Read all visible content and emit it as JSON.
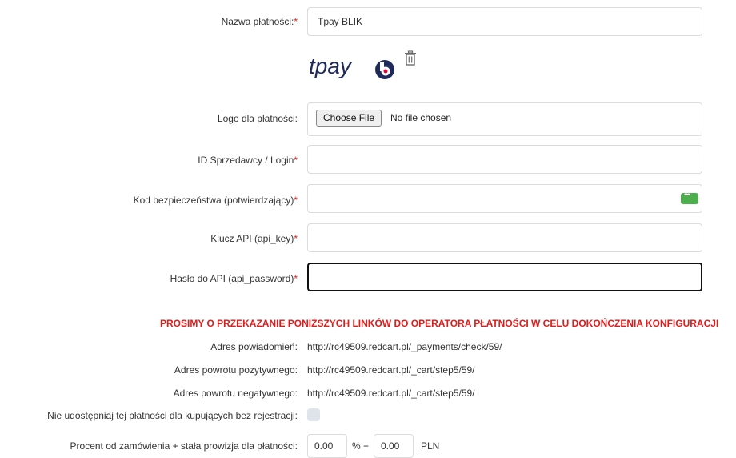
{
  "fields": {
    "payment_name": {
      "label": "Nazwa płatności:",
      "req": "*",
      "value": "Tpay BLIK"
    },
    "payment_logo": {
      "label": "Logo dla płatności:",
      "button": "Choose File",
      "status": "No file chosen"
    },
    "merchant_id": {
      "label": "ID Sprzedawcy / Login",
      "req": "*",
      "value": ""
    },
    "security_code": {
      "label": "Kod bezpieczeństwa (potwierdzający)",
      "req": "*",
      "value": ""
    },
    "api_key": {
      "label": "Klucz API (api_key)",
      "req": "*",
      "value": ""
    },
    "api_password": {
      "label": "Hasło do API (api_password)",
      "req": "*",
      "value": ""
    }
  },
  "logo": {
    "brand_text": "tpay",
    "badge_letter": "b"
  },
  "icons": {
    "delete": "trash-icon",
    "password_manager": "password-key-icon"
  },
  "notice": "PROSIMY O PRZEKAZANIE PONIŻSZYCH LINKÓW DO OPERATORA PŁATNOŚCI W CELU DOKOŃCZENIA KONFIGURACJI",
  "links": [
    {
      "label": "Adres powiadomień:",
      "url": "http://rc49509.redcart.pl/_payments/check/59/"
    },
    {
      "label": "Adres powrotu pozytywnego:",
      "url": "http://rc49509.redcart.pl/_cart/step5/59/"
    },
    {
      "label": "Adres powrotu negatywnego:",
      "url": "http://rc49509.redcart.pl/_cart/step5/59/"
    }
  ],
  "guest": {
    "label": "Nie udostępniaj tej płatności dla kupujących bez rejestracji:",
    "checked": false
  },
  "fee": {
    "label": "Procent od zamówienia + stała prowizja dla płatności:",
    "percent": "0.00",
    "percent_suffix": "% +",
    "fixed": "0.00",
    "currency": "PLN"
  },
  "colors": {
    "required": "#e02020",
    "notice": "#e21b1b",
    "brand": "#1f2a5a",
    "badge_accent": "#e4003a"
  }
}
